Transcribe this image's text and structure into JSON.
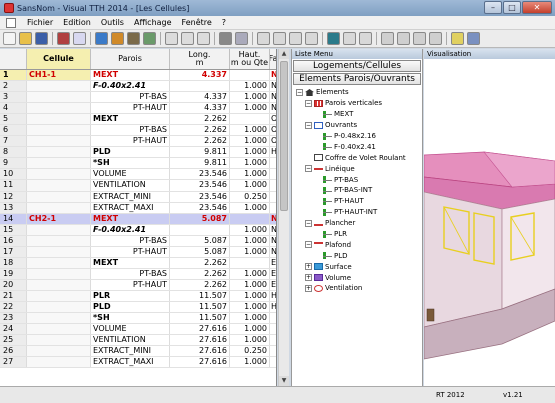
{
  "window": {
    "title": "SansNom - Visual TTH 2014 - [Les Cellules]",
    "btn_min": "–",
    "btn_max": "□",
    "btn_close": "✕"
  },
  "menu": [
    "Fichier",
    "Edition",
    "Outils",
    "Affichage",
    "Fenêtre",
    "?"
  ],
  "table": {
    "headers": {
      "cellule": "Cellule",
      "parois": "Parois",
      "long_1": "Long.",
      "long_2": "m",
      "haut_1": "Haut.",
      "haut_2": "m ou Qte",
      "fa": "Fa"
    },
    "rows": [
      {
        "n": "1",
        "cel": "CH1-1",
        "par": "MEXT",
        "long": "4.337",
        "haut": "",
        "fa": "N"
      },
      {
        "n": "2",
        "cel": "",
        "par": "F-0.40x2.41",
        "long": "",
        "haut": "1.000",
        "fa": "N"
      },
      {
        "n": "3",
        "cel": "",
        "par": "PT-BAS",
        "long": "4.337",
        "haut": "1.000",
        "fa": "N"
      },
      {
        "n": "4",
        "cel": "",
        "par": "PT-HAUT",
        "long": "4.337",
        "haut": "1.000",
        "fa": "N"
      },
      {
        "n": "5",
        "cel": "",
        "par": "MEXT",
        "long": "2.262",
        "haut": "",
        "fa": "O"
      },
      {
        "n": "6",
        "cel": "",
        "par": "PT-BAS",
        "long": "2.262",
        "haut": "1.000",
        "fa": "O"
      },
      {
        "n": "7",
        "cel": "",
        "par": "PT-HAUT",
        "long": "2.262",
        "haut": "1.000",
        "fa": "O"
      },
      {
        "n": "8",
        "cel": "",
        "par": "PLD",
        "long": "9.811",
        "haut": "1.000",
        "fa": "H"
      },
      {
        "n": "9",
        "cel": "",
        "par": "*SH",
        "long": "9.811",
        "haut": "1.000",
        "fa": ""
      },
      {
        "n": "10",
        "cel": "",
        "par": "VOLUME",
        "long": "23.546",
        "haut": "1.000",
        "fa": ""
      },
      {
        "n": "11",
        "cel": "",
        "par": "VENTILATION",
        "long": "23.546",
        "haut": "1.000",
        "fa": ""
      },
      {
        "n": "12",
        "cel": "",
        "par": "EXTRACT_MINI",
        "long": "23.546",
        "haut": "0.250",
        "fa": ""
      },
      {
        "n": "13",
        "cel": "",
        "par": "EXTRACT_MAXI",
        "long": "23.546",
        "haut": "1.000",
        "fa": ""
      },
      {
        "n": "14",
        "cel": "CH2-1",
        "par": "MEXT",
        "long": "5.087",
        "haut": "",
        "fa": "N"
      },
      {
        "n": "15",
        "cel": "",
        "par": "F-0.40x2.41",
        "long": "",
        "haut": "1.000",
        "fa": "N"
      },
      {
        "n": "16",
        "cel": "",
        "par": "PT-BAS",
        "long": "5.087",
        "haut": "1.000",
        "fa": "N"
      },
      {
        "n": "17",
        "cel": "",
        "par": "PT-HAUT",
        "long": "5.087",
        "haut": "1.000",
        "fa": "N"
      },
      {
        "n": "18",
        "cel": "",
        "par": "MEXT",
        "long": "2.262",
        "haut": "",
        "fa": "E"
      },
      {
        "n": "19",
        "cel": "",
        "par": "PT-BAS",
        "long": "2.262",
        "haut": "1.000",
        "fa": "E"
      },
      {
        "n": "20",
        "cel": "",
        "par": "PT-HAUT",
        "long": "2.262",
        "haut": "1.000",
        "fa": "E"
      },
      {
        "n": "21",
        "cel": "",
        "par": "PLR",
        "long": "11.507",
        "haut": "1.000",
        "fa": "H"
      },
      {
        "n": "22",
        "cel": "",
        "par": "PLD",
        "long": "11.507",
        "haut": "1.000",
        "fa": "H"
      },
      {
        "n": "23",
        "cel": "",
        "par": "*SH",
        "long": "11.507",
        "haut": "1.000",
        "fa": ""
      },
      {
        "n": "24",
        "cel": "",
        "par": "VOLUME",
        "long": "27.616",
        "haut": "1.000",
        "fa": ""
      },
      {
        "n": "25",
        "cel": "",
        "par": "VENTILATION",
        "long": "27.616",
        "haut": "1.000",
        "fa": ""
      },
      {
        "n": "26",
        "cel": "",
        "par": "EXTRACT_MINI",
        "long": "27.616",
        "haut": "0.250",
        "fa": ""
      },
      {
        "n": "27",
        "cel": "",
        "par": "EXTRACT_MAXI",
        "long": "27.616",
        "haut": "1.000",
        "fa": ""
      }
    ]
  },
  "liste": {
    "title": "Liste Menu",
    "btn1": "Logements/Cellules",
    "btn2": "Elements Parois/Ouvrants",
    "tree": [
      {
        "label": "Elements",
        "indent": 0,
        "exp": "−",
        "icon": "home"
      },
      {
        "label": "Parois verticales",
        "indent": 1,
        "exp": "−",
        "icon": "wall"
      },
      {
        "label": "MEXT",
        "indent": 2,
        "exp": "",
        "icon": "item"
      },
      {
        "label": "Ouvrants",
        "indent": 1,
        "exp": "−",
        "icon": "window"
      },
      {
        "label": "P-0.48x2.16",
        "indent": 2,
        "exp": "",
        "icon": "item"
      },
      {
        "label": "F-0.40x2.41",
        "indent": 2,
        "exp": "",
        "icon": "item"
      },
      {
        "label": "Coffre de Volet Roulant",
        "indent": 1,
        "exp": "",
        "icon": "box"
      },
      {
        "label": "Linéique",
        "indent": 1,
        "exp": "−",
        "icon": "line"
      },
      {
        "label": "PT-BAS",
        "indent": 2,
        "exp": "",
        "icon": "item"
      },
      {
        "label": "PT-BAS-INT",
        "indent": 2,
        "exp": "",
        "icon": "item"
      },
      {
        "label": "PT-HAUT",
        "indent": 2,
        "exp": "",
        "icon": "item"
      },
      {
        "label": "PT-HAUT-INT",
        "indent": 2,
        "exp": "",
        "icon": "item"
      },
      {
        "label": "Plancher",
        "indent": 1,
        "exp": "−",
        "icon": "floor"
      },
      {
        "label": "PLR",
        "indent": 2,
        "exp": "",
        "icon": "item"
      },
      {
        "label": "Plafond",
        "indent": 1,
        "exp": "−",
        "icon": "ceiling"
      },
      {
        "label": "PLD",
        "indent": 2,
        "exp": "",
        "icon": "item"
      },
      {
        "label": "Surface",
        "indent": 1,
        "exp": "+",
        "icon": "surface"
      },
      {
        "label": "Volume",
        "indent": 1,
        "exp": "+",
        "icon": "volume"
      },
      {
        "label": "Ventilation",
        "indent": 1,
        "exp": "+",
        "icon": "vent"
      }
    ]
  },
  "viz": {
    "title": "Visualisation"
  },
  "status": {
    "rt": "RT 2012",
    "version": "v1.21"
  },
  "colors": {
    "highlight_yellow": "#f5efb0",
    "highlight_blue": "#c9ccf2",
    "accent_red": "#d00000",
    "roof_pink": "#e070a8"
  }
}
